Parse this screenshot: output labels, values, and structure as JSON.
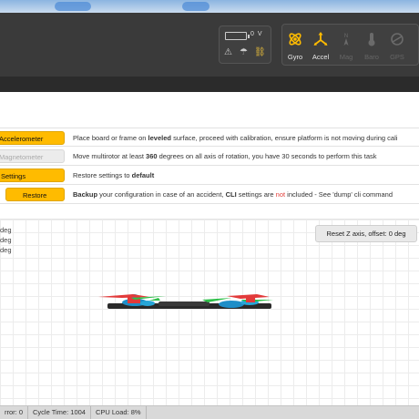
{
  "header": {
    "voltage": "0 V",
    "status_icons": [
      "warning-icon",
      "parachute-icon",
      "link-icon"
    ],
    "accent_color": "#ffbb00",
    "sensors": [
      {
        "label": "Gyro",
        "icon": "gyro-icon",
        "active": true
      },
      {
        "label": "Accel",
        "icon": "accel-icon",
        "active": true
      },
      {
        "label": "Mag",
        "icon": "compass-icon",
        "active": false
      },
      {
        "label": "Baro",
        "icon": "baro-icon",
        "active": false
      },
      {
        "label": "GPS",
        "icon": "gps-icon",
        "active": false
      }
    ]
  },
  "calibration": {
    "accel_button": "Accelerometer",
    "accel_desc_pre": "Place board or frame on ",
    "accel_desc_bold": "leveled",
    "accel_desc_post": " surface, proceed with calibration, ensure platform is not moving during cali",
    "mag_button": "Magnetometer",
    "mag_desc_pre": "Move multirotor at least ",
    "mag_desc_bold": "360",
    "mag_desc_post": " degrees on all axis of rotation, you have 30 seconds to perform this task",
    "settings_button": "Settings",
    "settings_desc_pre": "Restore settings to ",
    "settings_desc_bold": "default",
    "restore_button": "Restore",
    "restore_desc_bold1": "Backup",
    "restore_desc_mid1": " your configuration in case of an accident, ",
    "restore_desc_bold2": "CLI",
    "restore_desc_mid2": " settings are ",
    "restore_desc_red": "not",
    "restore_desc_post": " included - See 'dump' cli command"
  },
  "view": {
    "deg_lines": [
      "deg",
      "deg",
      "deg"
    ],
    "reset_button": "Reset Z axis, offset: 0 deg"
  },
  "footer": {
    "i2c_error": "rror: 0",
    "cycle_time": "Cycle Time: 1004",
    "cpu_load": "CPU Load: 8%"
  }
}
